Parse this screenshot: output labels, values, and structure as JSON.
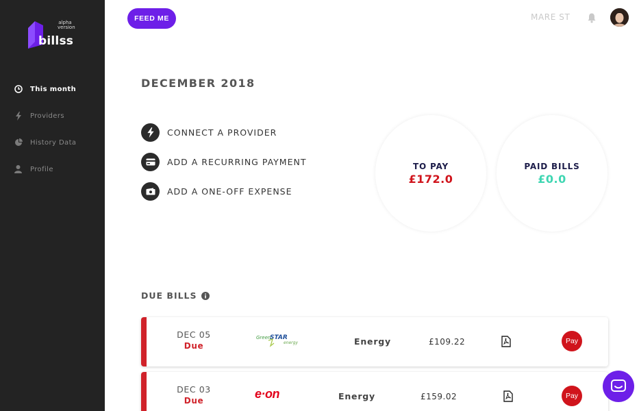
{
  "brand": {
    "name": "billss",
    "tag_line1": "alpha",
    "tag_line2": "version",
    "color": "#6d1fe8"
  },
  "sidebar": {
    "items": [
      {
        "label": "This month",
        "icon": "clock-icon",
        "active": true
      },
      {
        "label": "Providers",
        "icon": "bolt-icon",
        "active": false
      },
      {
        "label": "History Data",
        "icon": "pie-chart-icon",
        "active": false
      },
      {
        "label": "Profile",
        "icon": "user-icon",
        "active": false
      }
    ]
  },
  "header": {
    "feed_button": "FEED ME",
    "username": "MARE ST",
    "bell_icon": "bell-icon"
  },
  "main": {
    "month_title": "DECEMBER 2018",
    "actions": [
      {
        "label": "CONNECT A PROVIDER",
        "icon": "bolt-icon"
      },
      {
        "label": "ADD A RECURRING PAYMENT",
        "icon": "card-icon"
      },
      {
        "label": "ADD A ONE-OFF EXPENSE",
        "icon": "cash-icon"
      }
    ],
    "summary": {
      "to_pay": {
        "title": "TO PAY",
        "value": "£172.0",
        "color": "#d0141c"
      },
      "paid": {
        "title": "PAID BILLS",
        "value": "£0.0",
        "color": "#3fd6b2"
      }
    },
    "due_bills": {
      "title": "DUE BILLS",
      "rows": [
        {
          "date": "DEC 05",
          "status": "Due",
          "provider": "Green STAR energy",
          "provider_logo_top": "Green",
          "provider_logo_mid": "STAR",
          "provider_logo_bottom": "energy",
          "category": "Energy",
          "amount": "£109.22",
          "pay_label": "Pay"
        },
        {
          "date": "DEC 03",
          "status": "Due",
          "provider": "e-on",
          "provider_logo": "e·on",
          "category": "Energy",
          "amount": "£159.02",
          "pay_label": "Pay"
        }
      ]
    }
  },
  "colors": {
    "sidebar_bg": "#232323",
    "due_red": "#d0222a",
    "accent_purple": "#6d1fe8"
  }
}
